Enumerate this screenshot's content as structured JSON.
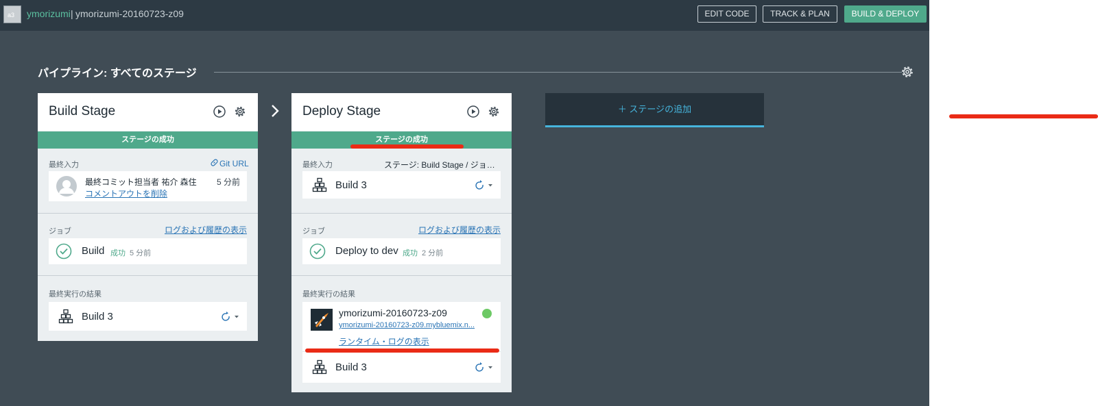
{
  "header": {
    "avatar_text": "a3",
    "org": "ymorizumi",
    "separator": "|",
    "app": "ymorizumi-20160723-z09",
    "buttons": {
      "edit_code": "EDIT CODE",
      "track_plan": "TRACK & PLAN",
      "build_deploy": "BUILD & DEPLOY"
    }
  },
  "pipeline": {
    "title": "パイプライン: すべてのステージ"
  },
  "build_stage": {
    "title": "Build Stage",
    "status": "ステージの成功",
    "input_label": "最終入力",
    "input_link": "Git URL",
    "commit_line": "最終コミット担当者 祐介 森住",
    "commit_time": "5 分前",
    "commit_message": "コメントアウトを削除",
    "jobs_label": "ジョブ",
    "jobs_link": "ログおよび履歴の表示",
    "job_name": "Build",
    "job_status": "成功",
    "job_time": "5 分前",
    "result_label": "最終実行の結果",
    "result_build": "Build 3"
  },
  "deploy_stage": {
    "title": "Deploy Stage",
    "status": "ステージの成功",
    "input_label": "最終入力",
    "input_source": "ステージ: Build Stage  /  ジョ…",
    "input_build": "Build 3",
    "jobs_label": "ジョブ",
    "jobs_link": "ログおよび履歴の表示",
    "job_name": "Deploy to dev",
    "job_status": "成功",
    "job_time": "2 分前",
    "result_label": "最終実行の結果",
    "app_name": "ymorizumi-20160723-z09",
    "app_url": "ymorizumi-20160723-z09.mybluemix.n...",
    "runtime_log": "ランタイム・ログの表示",
    "result_build": "Build 3"
  },
  "add_stage": {
    "label": "＋ ステージの追加"
  },
  "colors": {
    "accent": "#4fa98b",
    "link": "#2a74b5",
    "add_stage": "#46b5dd",
    "annotation": "#ea2b16"
  },
  "icons": [
    "gear-icon",
    "play-icon",
    "chevron-right-icon",
    "check-circle-icon",
    "build-icon",
    "redeploy-icon",
    "avatar-icon",
    "link-icon",
    "app-icon",
    "status-dot-icon"
  ]
}
